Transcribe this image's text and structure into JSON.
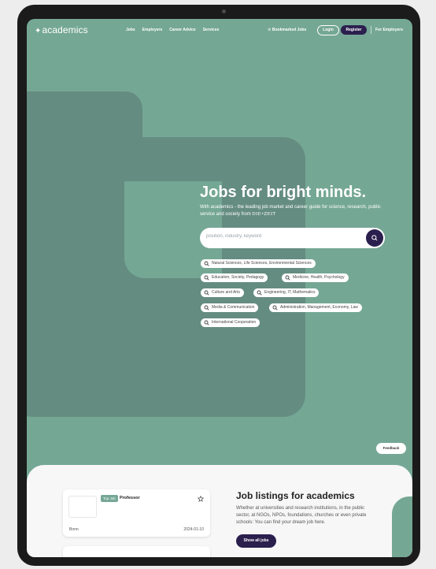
{
  "brand": {
    "name": "academics"
  },
  "nav": {
    "links": [
      "Jobs",
      "Employers",
      "Career Advice",
      "Services"
    ],
    "bookmarked": "Bookmarked Jobs",
    "login": "Login",
    "register": "Register",
    "for_employers": "For Employers"
  },
  "hero": {
    "title": "Jobs for bright minds.",
    "subtitle": "With academics - the leading job market and career guide for science, research, public service and society from",
    "partner": "DIE•ZEIT"
  },
  "search": {
    "placeholder": "position, industry, keyword",
    "value": ""
  },
  "categories": [
    "Natural Sciences, Life Sciences, Environmental Sciences",
    "Education, Society, Pedagogy",
    "Medicine, Health, Psychology",
    "Culture and Arts",
    "Engineering, IT, Mathematics",
    "Media & Communication",
    "Administration, Management, Economy, Law",
    "International Cooperation"
  ],
  "feedback": "Feedback",
  "job_card": {
    "badge": "Top Job",
    "title": "Professor",
    "location": "Bonn",
    "date": "2024-01-10"
  },
  "listings": {
    "title": "Job listings for academics",
    "text": "Whether at universities and research institutions, in the public sector, at NGOs, NPOs, foundations, churches or even private schools: You can find your dream job here.",
    "button": "Show all jobs"
  },
  "colors": {
    "accent": "#75a795",
    "accent_dark": "#658c81",
    "primary": "#2b1f4d",
    "page_bg": "#ededed"
  },
  "icons": [
    "search-icon",
    "star-icon",
    "logo-mark-icon"
  ]
}
